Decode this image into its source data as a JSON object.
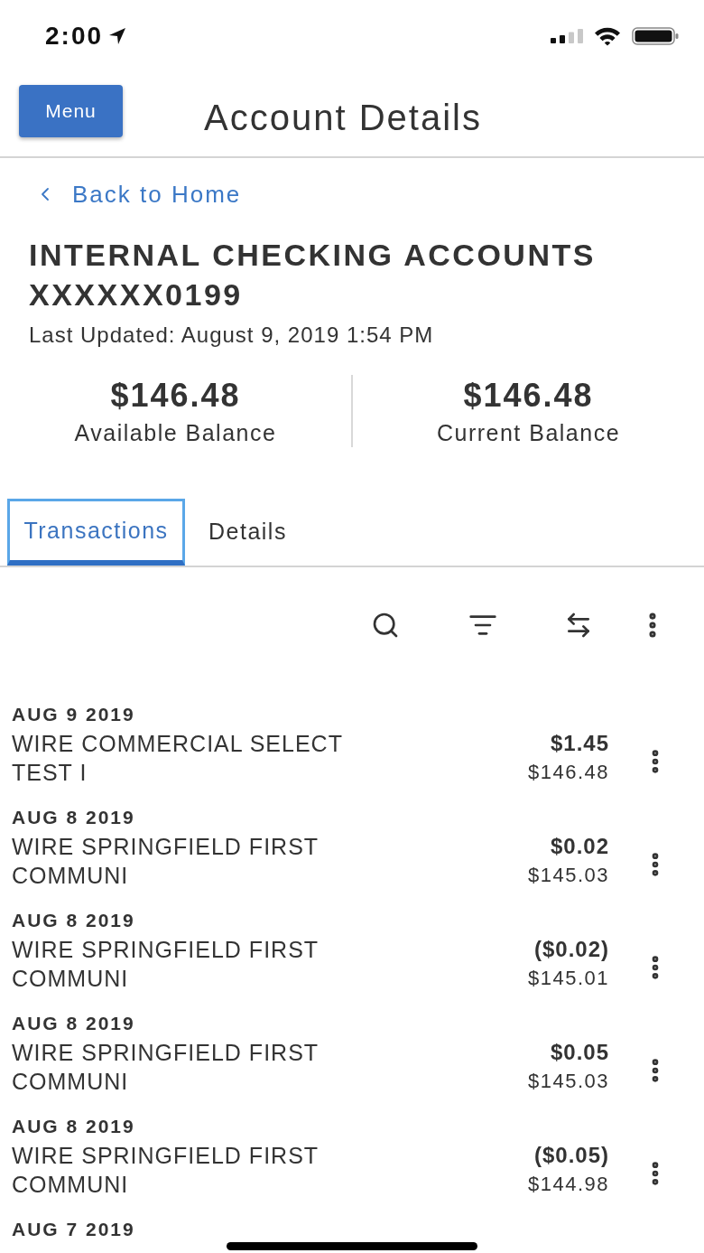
{
  "status_bar": {
    "time": "2:00"
  },
  "header": {
    "menu_button": "Menu",
    "title": "Account Details"
  },
  "back_link": "Back to Home",
  "account": {
    "name": "INTERNAL CHECKING ACCOUNTS",
    "number": "XXXXXX0199",
    "last_updated": "Last Updated: August 9, 2019 1:54 PM"
  },
  "balances": [
    {
      "amount": "$146.48",
      "label": "Available Balance"
    },
    {
      "amount": "$146.48",
      "label": "Current Balance"
    }
  ],
  "tabs": [
    {
      "label": "Transactions",
      "selected": true
    },
    {
      "label": "Details",
      "selected": false
    }
  ],
  "transactions": [
    {
      "date": "AUG 9 2019",
      "description": "WIRE COMMERCIAL SELECT TEST I",
      "amount": "$1.45",
      "balance": "$146.48"
    },
    {
      "date": "AUG 8 2019",
      "description": "WIRE SPRINGFIELD FIRST COMMUNI",
      "amount": "$0.02",
      "balance": "$145.03"
    },
    {
      "date": "AUG 8 2019",
      "description": "WIRE SPRINGFIELD FIRST COMMUNI",
      "amount": "($0.02)",
      "balance": "$145.01"
    },
    {
      "date": "AUG 8 2019",
      "description": "WIRE SPRINGFIELD FIRST COMMUNI",
      "amount": "$0.05",
      "balance": "$145.03"
    },
    {
      "date": "AUG 8 2019",
      "description": "WIRE SPRINGFIELD FIRST COMMUNI",
      "amount": "($0.05)",
      "balance": "$144.98"
    },
    {
      "date": "AUG 7 2019"
    }
  ]
}
